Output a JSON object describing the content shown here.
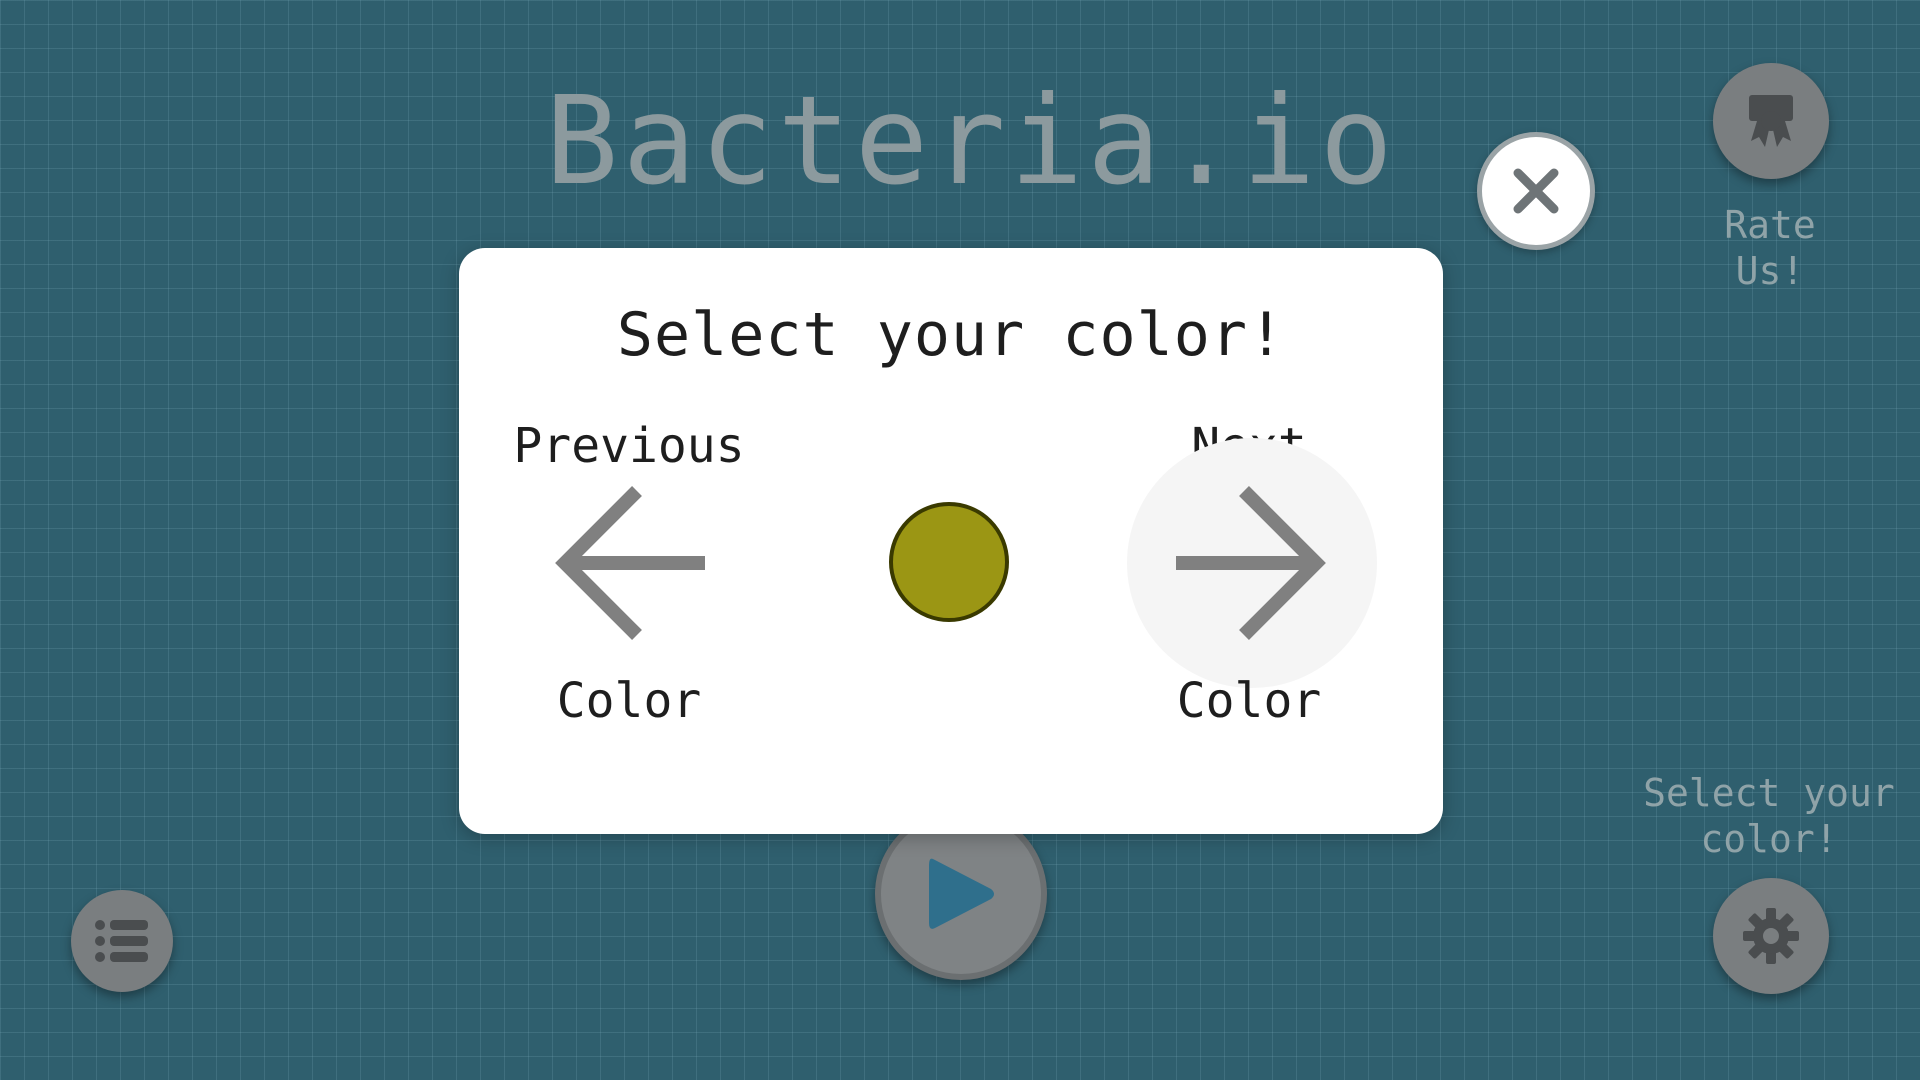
{
  "game": {
    "title": "Bacteria.io"
  },
  "top_right": {
    "rate_label": "Rate\nUs!"
  },
  "bottom_right": {
    "select_color_label": "Select your\ncolor!"
  },
  "modal": {
    "title": "Select your color!",
    "previous_top": "Previous",
    "previous_bottom": "Color",
    "next_top": "Next",
    "next_bottom": "Color",
    "selected_color": "#9b9614"
  },
  "icons": {
    "close": "close-icon",
    "rate": "ribbon-award-icon",
    "settings": "gear-icon",
    "leaderboard": "list-icon",
    "play": "play-icon",
    "previous": "arrow-left-icon",
    "next": "arrow-right-icon"
  },
  "colors": {
    "background": "#2f5f6e",
    "button_gray": "#7a7e80",
    "play_triangle": "#2f6f8c",
    "arrow_gray": "#808080",
    "title_gray": "#8c9a9e"
  }
}
